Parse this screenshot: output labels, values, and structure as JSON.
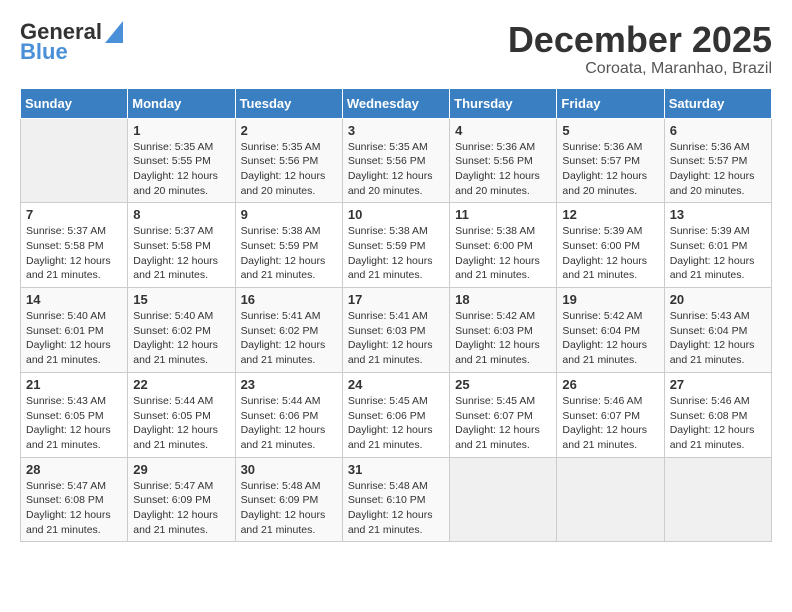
{
  "logo": {
    "line1": "General",
    "line2": "Blue"
  },
  "title": "December 2025",
  "subtitle": "Coroata, Maranhao, Brazil",
  "days_of_week": [
    "Sunday",
    "Monday",
    "Tuesday",
    "Wednesday",
    "Thursday",
    "Friday",
    "Saturday"
  ],
  "weeks": [
    [
      {
        "num": "",
        "empty": true
      },
      {
        "num": "1",
        "sunrise": "Sunrise: 5:35 AM",
        "sunset": "Sunset: 5:55 PM",
        "daylight": "Daylight: 12 hours and 20 minutes."
      },
      {
        "num": "2",
        "sunrise": "Sunrise: 5:35 AM",
        "sunset": "Sunset: 5:56 PM",
        "daylight": "Daylight: 12 hours and 20 minutes."
      },
      {
        "num": "3",
        "sunrise": "Sunrise: 5:35 AM",
        "sunset": "Sunset: 5:56 PM",
        "daylight": "Daylight: 12 hours and 20 minutes."
      },
      {
        "num": "4",
        "sunrise": "Sunrise: 5:36 AM",
        "sunset": "Sunset: 5:56 PM",
        "daylight": "Daylight: 12 hours and 20 minutes."
      },
      {
        "num": "5",
        "sunrise": "Sunrise: 5:36 AM",
        "sunset": "Sunset: 5:57 PM",
        "daylight": "Daylight: 12 hours and 20 minutes."
      },
      {
        "num": "6",
        "sunrise": "Sunrise: 5:36 AM",
        "sunset": "Sunset: 5:57 PM",
        "daylight": "Daylight: 12 hours and 20 minutes."
      }
    ],
    [
      {
        "num": "7",
        "sunrise": "Sunrise: 5:37 AM",
        "sunset": "Sunset: 5:58 PM",
        "daylight": "Daylight: 12 hours and 21 minutes."
      },
      {
        "num": "8",
        "sunrise": "Sunrise: 5:37 AM",
        "sunset": "Sunset: 5:58 PM",
        "daylight": "Daylight: 12 hours and 21 minutes."
      },
      {
        "num": "9",
        "sunrise": "Sunrise: 5:38 AM",
        "sunset": "Sunset: 5:59 PM",
        "daylight": "Daylight: 12 hours and 21 minutes."
      },
      {
        "num": "10",
        "sunrise": "Sunrise: 5:38 AM",
        "sunset": "Sunset: 5:59 PM",
        "daylight": "Daylight: 12 hours and 21 minutes."
      },
      {
        "num": "11",
        "sunrise": "Sunrise: 5:38 AM",
        "sunset": "Sunset: 6:00 PM",
        "daylight": "Daylight: 12 hours and 21 minutes."
      },
      {
        "num": "12",
        "sunrise": "Sunrise: 5:39 AM",
        "sunset": "Sunset: 6:00 PM",
        "daylight": "Daylight: 12 hours and 21 minutes."
      },
      {
        "num": "13",
        "sunrise": "Sunrise: 5:39 AM",
        "sunset": "Sunset: 6:01 PM",
        "daylight": "Daylight: 12 hours and 21 minutes."
      }
    ],
    [
      {
        "num": "14",
        "sunrise": "Sunrise: 5:40 AM",
        "sunset": "Sunset: 6:01 PM",
        "daylight": "Daylight: 12 hours and 21 minutes."
      },
      {
        "num": "15",
        "sunrise": "Sunrise: 5:40 AM",
        "sunset": "Sunset: 6:02 PM",
        "daylight": "Daylight: 12 hours and 21 minutes."
      },
      {
        "num": "16",
        "sunrise": "Sunrise: 5:41 AM",
        "sunset": "Sunset: 6:02 PM",
        "daylight": "Daylight: 12 hours and 21 minutes."
      },
      {
        "num": "17",
        "sunrise": "Sunrise: 5:41 AM",
        "sunset": "Sunset: 6:03 PM",
        "daylight": "Daylight: 12 hours and 21 minutes."
      },
      {
        "num": "18",
        "sunrise": "Sunrise: 5:42 AM",
        "sunset": "Sunset: 6:03 PM",
        "daylight": "Daylight: 12 hours and 21 minutes."
      },
      {
        "num": "19",
        "sunrise": "Sunrise: 5:42 AM",
        "sunset": "Sunset: 6:04 PM",
        "daylight": "Daylight: 12 hours and 21 minutes."
      },
      {
        "num": "20",
        "sunrise": "Sunrise: 5:43 AM",
        "sunset": "Sunset: 6:04 PM",
        "daylight": "Daylight: 12 hours and 21 minutes."
      }
    ],
    [
      {
        "num": "21",
        "sunrise": "Sunrise: 5:43 AM",
        "sunset": "Sunset: 6:05 PM",
        "daylight": "Daylight: 12 hours and 21 minutes."
      },
      {
        "num": "22",
        "sunrise": "Sunrise: 5:44 AM",
        "sunset": "Sunset: 6:05 PM",
        "daylight": "Daylight: 12 hours and 21 minutes."
      },
      {
        "num": "23",
        "sunrise": "Sunrise: 5:44 AM",
        "sunset": "Sunset: 6:06 PM",
        "daylight": "Daylight: 12 hours and 21 minutes."
      },
      {
        "num": "24",
        "sunrise": "Sunrise: 5:45 AM",
        "sunset": "Sunset: 6:06 PM",
        "daylight": "Daylight: 12 hours and 21 minutes."
      },
      {
        "num": "25",
        "sunrise": "Sunrise: 5:45 AM",
        "sunset": "Sunset: 6:07 PM",
        "daylight": "Daylight: 12 hours and 21 minutes."
      },
      {
        "num": "26",
        "sunrise": "Sunrise: 5:46 AM",
        "sunset": "Sunset: 6:07 PM",
        "daylight": "Daylight: 12 hours and 21 minutes."
      },
      {
        "num": "27",
        "sunrise": "Sunrise: 5:46 AM",
        "sunset": "Sunset: 6:08 PM",
        "daylight": "Daylight: 12 hours and 21 minutes."
      }
    ],
    [
      {
        "num": "28",
        "sunrise": "Sunrise: 5:47 AM",
        "sunset": "Sunset: 6:08 PM",
        "daylight": "Daylight: 12 hours and 21 minutes."
      },
      {
        "num": "29",
        "sunrise": "Sunrise: 5:47 AM",
        "sunset": "Sunset: 6:09 PM",
        "daylight": "Daylight: 12 hours and 21 minutes."
      },
      {
        "num": "30",
        "sunrise": "Sunrise: 5:48 AM",
        "sunset": "Sunset: 6:09 PM",
        "daylight": "Daylight: 12 hours and 21 minutes."
      },
      {
        "num": "31",
        "sunrise": "Sunrise: 5:48 AM",
        "sunset": "Sunset: 6:10 PM",
        "daylight": "Daylight: 12 hours and 21 minutes."
      },
      {
        "num": "",
        "empty": true
      },
      {
        "num": "",
        "empty": true
      },
      {
        "num": "",
        "empty": true
      }
    ]
  ]
}
